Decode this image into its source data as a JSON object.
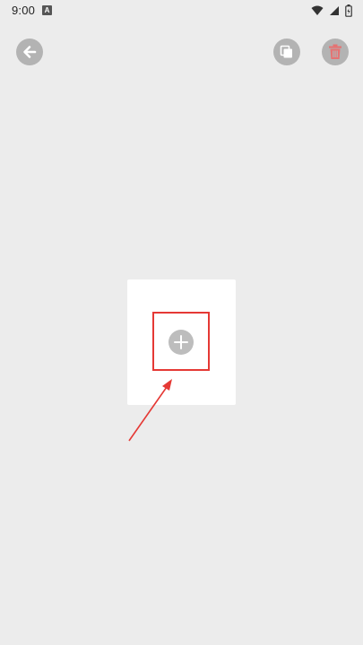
{
  "status_bar": {
    "time": "9:00",
    "notification_icon": "A",
    "icons": [
      "wifi-icon",
      "signal-icon",
      "battery-icon"
    ]
  },
  "toolbar": {
    "back_icon": "arrow-left-icon",
    "copy_icon": "copy-icon",
    "delete_icon": "trash-icon"
  },
  "colors": {
    "background": "#ececec",
    "button_gray": "#b3b3b3",
    "delete_red": "#e57373",
    "highlight_red": "#e53935",
    "card": "#ffffff"
  },
  "content": {
    "add_icon": "plus-icon"
  }
}
